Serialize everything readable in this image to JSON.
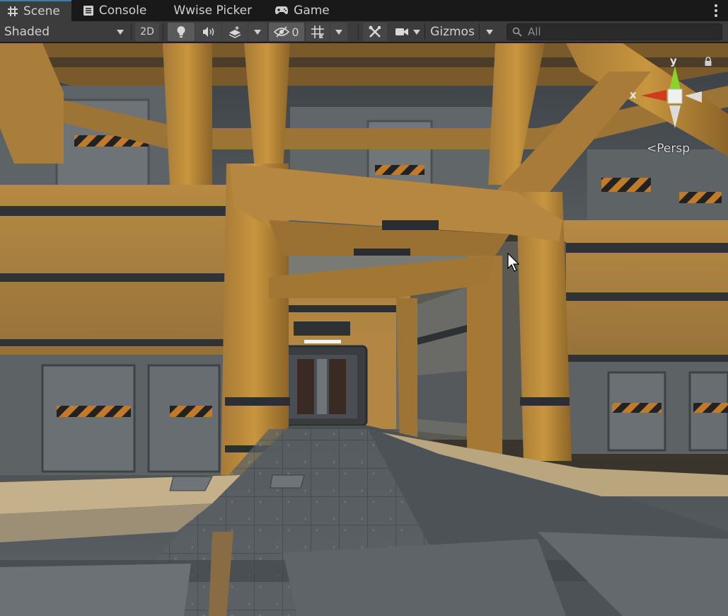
{
  "tabs": [
    {
      "label": "Scene",
      "icon": "grid-hash-icon",
      "active": true
    },
    {
      "label": "Console",
      "icon": "console-icon",
      "active": false
    },
    {
      "label": "Wwise Picker",
      "icon": "",
      "active": false
    },
    {
      "label": "Game",
      "icon": "gamepad-icon",
      "active": false
    }
  ],
  "toolbar": {
    "shading_mode": "Shaded",
    "mode_2d": "2D",
    "hidden_count": "0",
    "gizmos_label": "Gizmos",
    "search_placeholder": "All"
  },
  "viewport": {
    "projection_label": "Persp",
    "axis_x": "x",
    "axis_y": "y",
    "colors": {
      "axis_x": "#d33a1c",
      "axis_y": "#8bd32a",
      "axis_neutral": "#e0e0e0",
      "accent_tab": "#3a79bb"
    }
  }
}
